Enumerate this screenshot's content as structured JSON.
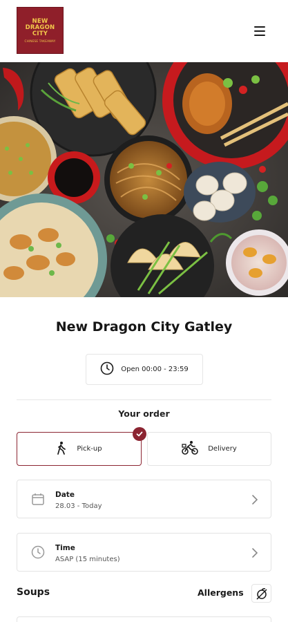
{
  "header": {
    "logo_line1": "NEW",
    "logo_line2": "DRAGON CITY",
    "logo_line3": "CHINESE TAKEAWAY",
    "menu_icon": "hamburger-menu-icon"
  },
  "hero": {
    "image": "chinese-food-spread-photo"
  },
  "restaurant": {
    "name": "New Dragon City Gatley",
    "hours": "Open 00:00 - 23:59",
    "hours_icon": "clock-icon"
  },
  "order": {
    "label": "Your order",
    "options": [
      {
        "label": "Pick-up",
        "icon": "walking-person-icon",
        "selected": true
      },
      {
        "label": "Delivery",
        "icon": "bicycle-delivery-icon",
        "selected": false
      }
    ],
    "date": {
      "title": "Date",
      "value": "28.03 - Today",
      "icon": "calendar-icon"
    },
    "time": {
      "title": "Time",
      "value": "ASAP (15 minutes)",
      "icon": "clock-icon"
    }
  },
  "menu_section": {
    "title": "Soups",
    "allergens_label": "Allergens",
    "allergens_icon": "allergen-filter-icon"
  },
  "colors": {
    "accent": "#8b2431",
    "logo_bg": "#8f1f2a",
    "logo_text": "#f2c84b",
    "border": "#e3e3e3"
  }
}
